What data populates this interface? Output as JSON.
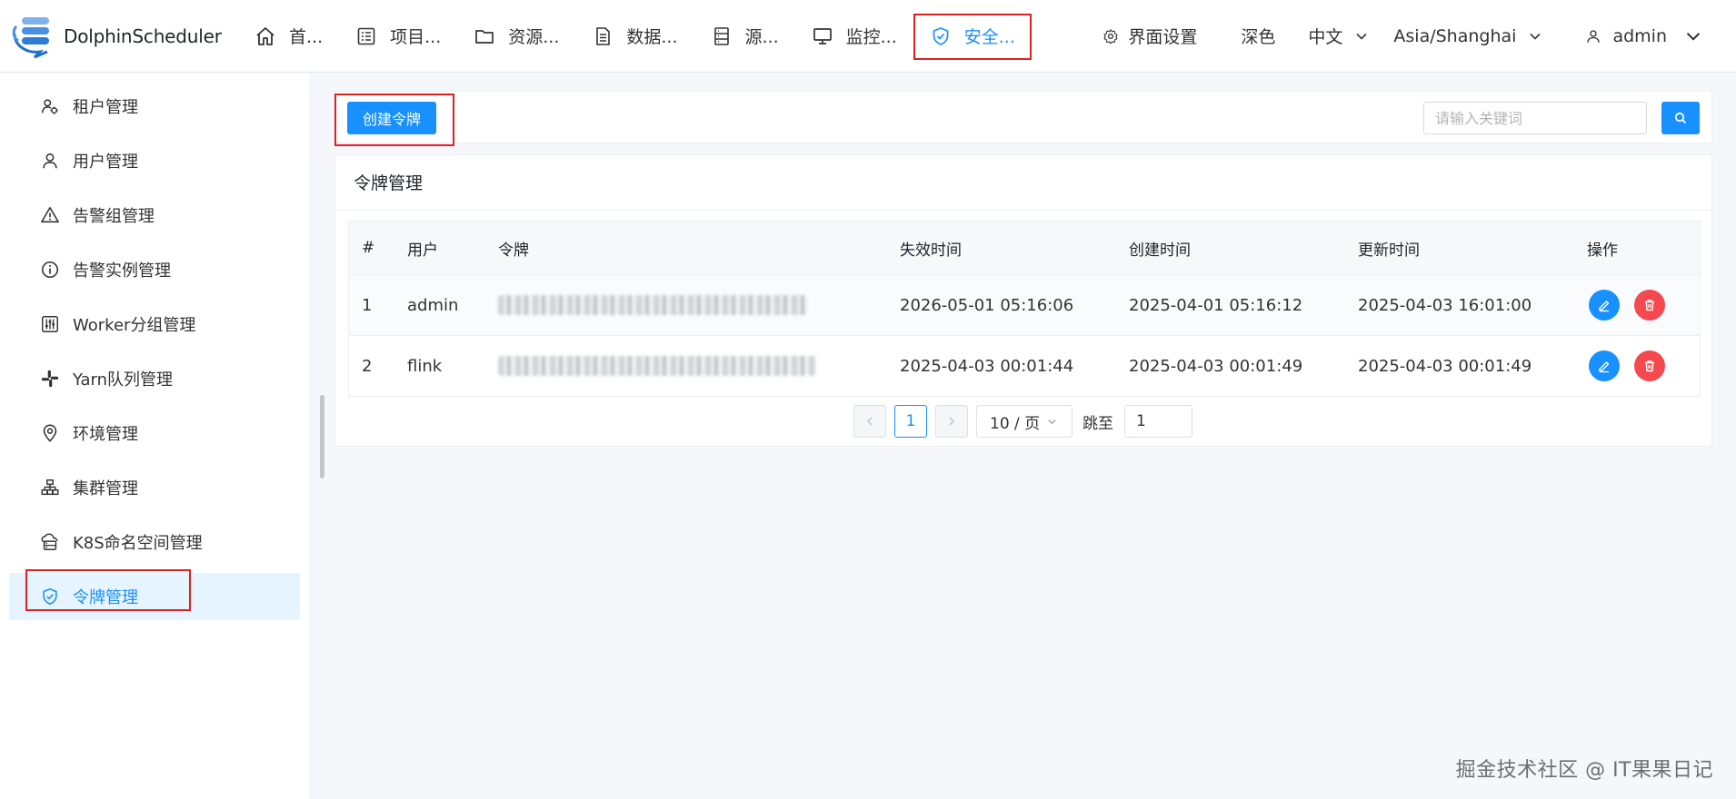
{
  "app": {
    "name": "DolphinScheduler"
  },
  "nav": [
    {
      "label": "首...",
      "icon": "home-icon"
    },
    {
      "label": "项目...",
      "icon": "project-list-icon"
    },
    {
      "label": "资源...",
      "icon": "folder-icon"
    },
    {
      "label": "数据...",
      "icon": "data-file-icon"
    },
    {
      "label": "源...",
      "icon": "datasource-icon"
    },
    {
      "label": "监控...",
      "icon": "monitor-icon"
    },
    {
      "label": "安全...",
      "icon": "shield-check-icon",
      "active": true
    }
  ],
  "header_right": {
    "ui_settings": "界面设置",
    "theme": "深色",
    "language": "中文",
    "timezone": "Asia/Shanghai",
    "user": "admin"
  },
  "sidebar": {
    "items": [
      {
        "label": "租户管理",
        "icon": "tenant-icon"
      },
      {
        "label": "用户管理",
        "icon": "user-icon"
      },
      {
        "label": "告警组管理",
        "icon": "warning-icon"
      },
      {
        "label": "告警实例管理",
        "icon": "info-icon"
      },
      {
        "label": "Worker分组管理",
        "icon": "sliders-icon"
      },
      {
        "label": "Yarn队列管理",
        "icon": "slack-icon"
      },
      {
        "label": "环境管理",
        "icon": "location-icon"
      },
      {
        "label": "集群管理",
        "icon": "cluster-icon"
      },
      {
        "label": "K8S命名空间管理",
        "icon": "cloud-server-icon"
      },
      {
        "label": "令牌管理",
        "icon": "shield-check-icon",
        "active": true
      }
    ]
  },
  "toolbar": {
    "create_label": "创建令牌",
    "search_placeholder": "请输入关键词"
  },
  "card": {
    "title": "令牌管理",
    "columns": [
      "#",
      "用户",
      "令牌",
      "失效时间",
      "创建时间",
      "更新时间",
      "操作"
    ],
    "rows": [
      {
        "index": "1",
        "user": "admin",
        "token": "",
        "expire": "2026-05-01 05:16:06",
        "created": "2025-04-01 05:16:12",
        "updated": "2025-04-03 16:01:00"
      },
      {
        "index": "2",
        "user": "flink",
        "token": "",
        "expire": "2025-04-03 00:01:44",
        "created": "2025-04-03 00:01:49",
        "updated": "2025-04-03 00:01:49"
      }
    ]
  },
  "pagination": {
    "current_page": "1",
    "page_size": "10 / 页",
    "jump_label": "跳至",
    "jump_value": "1"
  },
  "watermark": "掘金技术社区 @ IT果果日记",
  "colors": {
    "primary": "#1890ff",
    "danger": "#f5484f",
    "highlight_box": "#e02020"
  }
}
